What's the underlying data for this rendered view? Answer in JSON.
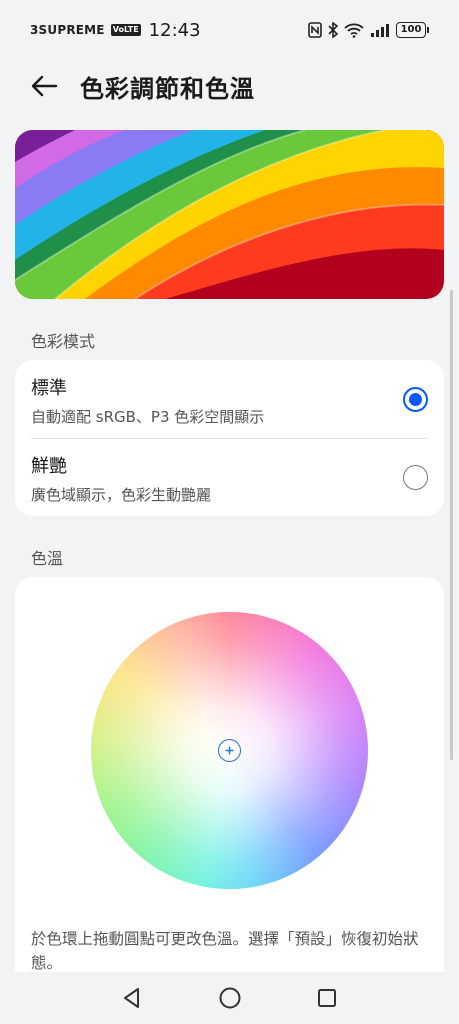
{
  "status_bar": {
    "carrier": "3SUPREME",
    "volte": "VoLTE",
    "time": "12:43",
    "battery": "100"
  },
  "header": {
    "title": "色彩調節和色溫"
  },
  "color_mode": {
    "section_label": "色彩模式",
    "options": [
      {
        "title": "標準",
        "subtitle": "自動適配 sRGB、P3 色彩空間顯示",
        "selected": true
      },
      {
        "title": "鮮艷",
        "subtitle": "廣色域顯示，色彩生動艷麗",
        "selected": false
      }
    ]
  },
  "color_temp": {
    "section_label": "色溫",
    "help_text": "於色環上拖動圓點可更改色溫。選擇「預設」恢復初始狀態。"
  },
  "colors": {
    "accent": "#0a59f7",
    "background": "#f1f3f5",
    "card": "#ffffff"
  },
  "icons": {
    "back": "arrow-left-icon",
    "nav_back": "triangle-back-icon",
    "nav_home": "circle-home-icon",
    "nav_recent": "square-recents-icon"
  }
}
